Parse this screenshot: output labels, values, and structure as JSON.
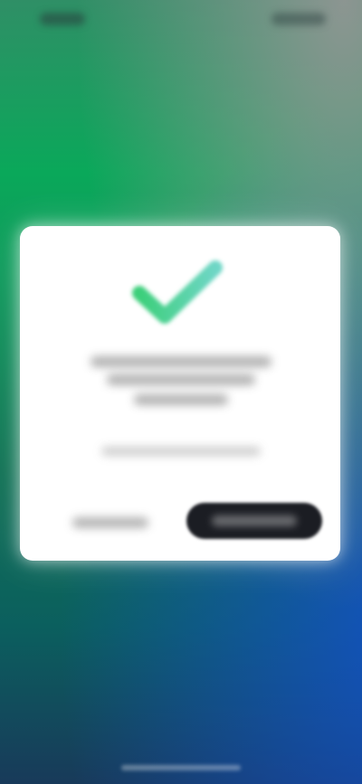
{
  "colors": {
    "background_top": "#2f8f66",
    "background_mid": "#0aa85a",
    "background_bottom": "#183a5a",
    "accent_blue": "#1450c8",
    "dialog_background": "#ffffff",
    "check_green": "#3ccf7a",
    "check_teal": "#6fd6c6",
    "primary_button": "#1b1d23"
  },
  "icons": {
    "success": "checkmark-icon"
  },
  "dialog": {
    "title": "",
    "message": "",
    "secondary_button_label": "",
    "primary_button_label": ""
  }
}
